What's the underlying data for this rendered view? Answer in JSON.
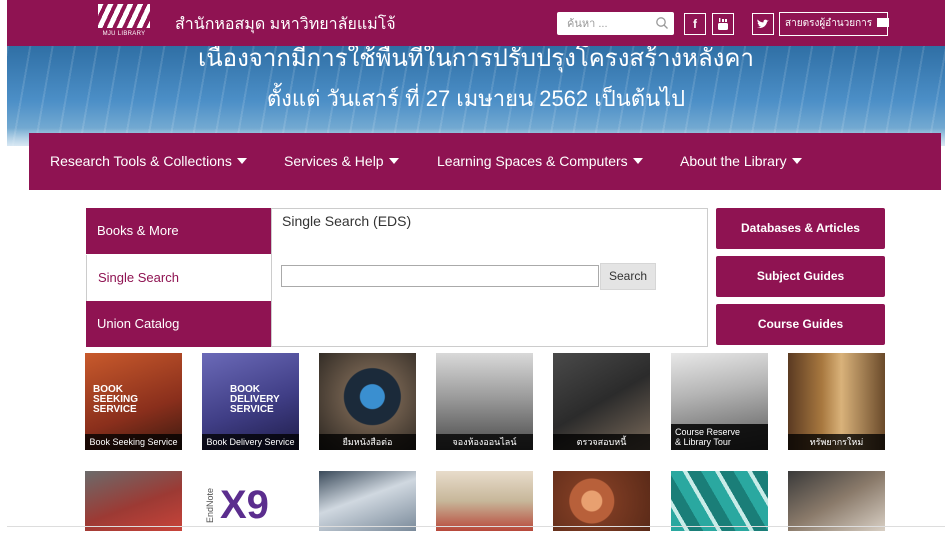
{
  "header": {
    "logo_caption": "MJU LIBRARY",
    "site_title": "สำนักหอสมุด มหาวิทยาลัยแม่โจ้",
    "search_placeholder": "ค้นหา ...",
    "director_link": "สายตรงผู้อำนวยการ",
    "icons": [
      "search-icon",
      "facebook-icon",
      "youtube-icon",
      "twitter-icon",
      "mail-icon"
    ]
  },
  "banner": {
    "line1": "เนื่องจากมีการใช้พื้นที่ในการปรับปรุงโครงสร้างหลังคา",
    "line2": "ตั้งแต่ วันเสาร์ ที่ 27 เมษายน 2562 เป็นต้นไป"
  },
  "nav": {
    "items": [
      {
        "label": "Research Tools & Collections"
      },
      {
        "label": "Services & Help"
      },
      {
        "label": "Learning Spaces & Computers"
      },
      {
        "label": "About the Library"
      }
    ]
  },
  "search_widget": {
    "tabs": [
      {
        "label": "Books & More",
        "active": false
      },
      {
        "label": "Single Search",
        "active": true
      },
      {
        "label": "Union Catalog",
        "active": false
      }
    ],
    "panel_title": "Single Search (EDS)",
    "input_value": "",
    "button_label": "Search"
  },
  "side_buttons": [
    {
      "label": "Databases & Articles"
    },
    {
      "label": "Subject Guides"
    },
    {
      "label": "Course Guides"
    }
  ],
  "tiles_row1": [
    {
      "caption": "Book Seeking Service",
      "image_text": "BOOK SEEKING SERVICE"
    },
    {
      "caption": "Book Delivery Service",
      "image_text": "BOOK DELIVERY SERVICE"
    },
    {
      "caption": "ยืมหนังสือต่อ"
    },
    {
      "caption": "จองห้องออนไลน์"
    },
    {
      "caption": "ตรวจสอบหนี้"
    },
    {
      "caption_line1": "Course Reserve",
      "caption_line2": "& Library Tour"
    },
    {
      "caption": "ทรัพยากรใหม่"
    }
  ],
  "tiles_row2": [
    {
      "image_text": ""
    },
    {
      "image_text_side": "EndNote",
      "image_text": "X9"
    },
    {
      "image_text": ""
    },
    {
      "image_text": ""
    },
    {
      "image_text": ""
    },
    {
      "image_text": ""
    },
    {
      "image_text": ""
    }
  ],
  "colors": {
    "brand": "#8f1352",
    "banner_blue": "#3e7fb8"
  }
}
